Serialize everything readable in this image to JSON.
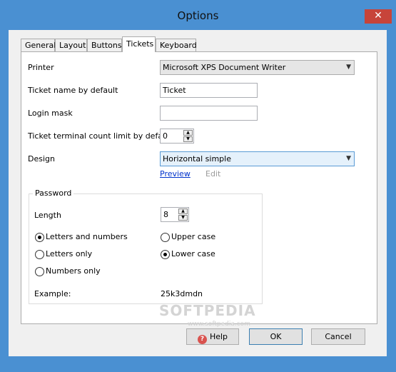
{
  "window": {
    "title": "Options",
    "close_glyph": "✕"
  },
  "tabs": [
    {
      "label": "General"
    },
    {
      "label": "Layout"
    },
    {
      "label": "Buttons"
    },
    {
      "label": "Tickets"
    },
    {
      "label": "Keyboard"
    }
  ],
  "active_tab": "Tickets",
  "form": {
    "printer_label": "Printer",
    "printer_value": "Microsoft XPS Document Writer",
    "ticket_name_label": "Ticket name by default",
    "ticket_name_value": "Ticket",
    "login_mask_label": "Login mask",
    "login_mask_value": "",
    "count_limit_label": "Ticket terminal count limit by default",
    "count_limit_value": "0",
    "design_label": "Design",
    "design_value": "Horizontal simple",
    "preview_link": "Preview",
    "edit_link": "Edit"
  },
  "password": {
    "group_title": "Password",
    "length_label": "Length",
    "length_value": "8",
    "options_left": [
      {
        "label": "Letters and numbers",
        "selected": true
      },
      {
        "label": "Letters only",
        "selected": false
      },
      {
        "label": "Numbers only",
        "selected": false
      }
    ],
    "options_right": [
      {
        "label": "Upper case",
        "selected": false
      },
      {
        "label": "Lower case",
        "selected": true
      }
    ],
    "example_label": "Example:",
    "example_value": "25k3dmdn"
  },
  "watermark": {
    "text": "SOFTPEDIA",
    "sub": "www.softpedia.com"
  },
  "buttons": {
    "help": "Help",
    "ok": "OK",
    "cancel": "Cancel"
  },
  "colors": {
    "frame": "#4a90d2",
    "close": "#c7443a",
    "link": "#0033cc"
  }
}
